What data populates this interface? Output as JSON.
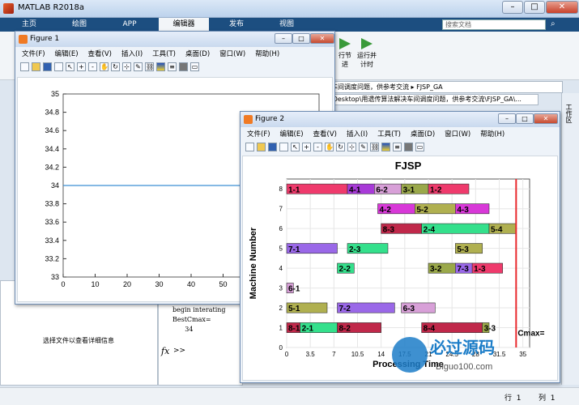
{
  "app": {
    "title": "MATLAB R2018a"
  },
  "ribbon_tabs": [
    "主页",
    "绘图",
    "APP",
    "编辑器",
    "发布",
    "视图"
  ],
  "search_placeholder": "搜索文档",
  "ribbon_buttons": [
    {
      "label": "行节\n进"
    },
    {
      "label": "运行并\n计时"
    }
  ],
  "address": {
    "path1": "车间调度问题，供参考交流 ▸ FJSP_GA",
    "path2": "\\Desktop\\用遗传算法解决车间调度问题，供参考交流\\FJSP_GA\\..."
  },
  "left_pane": {
    "message": "选择文件以查看详细信息"
  },
  "command_window": {
    "lines": [
      "begin interating",
      "BestCmax=",
      "      34"
    ],
    "prompt": ">>"
  },
  "side_label": "工作区",
  "status": {
    "row_label": "行",
    "row_value": "1",
    "col_label": "列",
    "col_value": "1"
  },
  "figure1": {
    "title": "Figure 1",
    "menu": [
      "文件(F)",
      "编辑(E)",
      "查看(V)",
      "插入(I)",
      "工具(T)",
      "桌面(D)",
      "窗口(W)",
      "帮助(H)"
    ],
    "yticks": [
      "35",
      "34.8",
      "34.6",
      "34.4",
      "34.2",
      "34",
      "33.8",
      "33.6",
      "33.4",
      "33.2",
      "33"
    ],
    "xticks": [
      "0",
      "10",
      "20",
      "30",
      "40",
      "50",
      "60",
      "70"
    ]
  },
  "figure2": {
    "title": "Figure 2",
    "menu": [
      "文件(F)",
      "编辑(E)",
      "查看(V)",
      "插入(I)",
      "工具(T)",
      "桌面(D)",
      "窗口(W)",
      "帮助(H)"
    ]
  },
  "chart_data": [
    {
      "type": "line",
      "ylim": [
        33,
        35
      ],
      "xlim": [
        0,
        80
      ],
      "x": [
        0,
        100
      ],
      "series": [
        {
          "values": [
            34,
            34
          ]
        }
      ],
      "yticks": [
        35,
        34.8,
        34.6,
        34.4,
        34.2,
        34,
        33.8,
        33.6,
        33.4,
        33.2,
        33
      ],
      "xticks": [
        0,
        10,
        20,
        30,
        40,
        50,
        60,
        70
      ],
      "color": "#3c8fd4"
    },
    {
      "type": "bar",
      "title": "FJSP",
      "xlabel": "Processing Time",
      "ylabel": "Machine Number",
      "xlim": [
        0,
        36
      ],
      "ylim": [
        0,
        8.5
      ],
      "xticks": [
        "0",
        "3.5",
        "7",
        "10.5",
        "14",
        "17.5",
        "21",
        "24.5",
        "28",
        "31.5",
        "35"
      ],
      "yticks": [
        "0",
        "1",
        "2",
        "3",
        "4",
        "5",
        "6",
        "7",
        "8"
      ],
      "cmax_label": "Cmax=",
      "cmax": 34,
      "cmax_color": "#e8282c",
      "tasks": [
        {
          "m": 8,
          "s": 0,
          "e": 9,
          "label": "1-1",
          "color": "#ef3a6c"
        },
        {
          "m": 8,
          "s": 9,
          "e": 13,
          "label": "4-1",
          "color": "#a83ad8"
        },
        {
          "m": 8,
          "s": 13,
          "e": 17,
          "label": "6-2",
          "color": "#d8a0d8"
        },
        {
          "m": 8,
          "s": 17,
          "e": 21,
          "label": "3-1",
          "color": "#9aa84a"
        },
        {
          "m": 8,
          "s": 21,
          "e": 27,
          "label": "1-2",
          "color": "#ef3a6c"
        },
        {
          "m": 7,
          "s": 13.5,
          "e": 19,
          "label": "4-2",
          "color": "#d838d8"
        },
        {
          "m": 7,
          "s": 19,
          "e": 25,
          "label": "5-2",
          "color": "#b0b050"
        },
        {
          "m": 7,
          "s": 25,
          "e": 30,
          "label": "4-3",
          "color": "#d838d8"
        },
        {
          "m": 6,
          "s": 14,
          "e": 20,
          "label": "8-3",
          "color": "#c0284a"
        },
        {
          "m": 6,
          "s": 20,
          "e": 30,
          "label": "2-4",
          "color": "#34e08c"
        },
        {
          "m": 6,
          "s": 30,
          "e": 34,
          "label": "5-4",
          "color": "#b0b050"
        },
        {
          "m": 5,
          "s": 0,
          "e": 7.5,
          "label": "7-1",
          "color": "#9a68e8"
        },
        {
          "m": 5,
          "s": 9,
          "e": 15,
          "label": "2-3",
          "color": "#34e08c"
        },
        {
          "m": 5,
          "s": 25,
          "e": 29,
          "label": "5-3",
          "color": "#b0b050"
        },
        {
          "m": 4,
          "s": 7.5,
          "e": 10,
          "label": "2-2",
          "color": "#34e08c"
        },
        {
          "m": 4,
          "s": 21,
          "e": 25,
          "label": "3-2",
          "color": "#9aa84a"
        },
        {
          "m": 4,
          "s": 25,
          "e": 27.5,
          "label": "7-3",
          "color": "#9a68e8"
        },
        {
          "m": 4,
          "s": 27.5,
          "e": 32,
          "label": "1-3",
          "color": "#ef3a6c"
        },
        {
          "m": 3,
          "s": 0,
          "e": 1,
          "label": "6-1",
          "color": "#d8a0d8"
        },
        {
          "m": 2,
          "s": 0,
          "e": 6,
          "label": "5-1",
          "color": "#b0b050"
        },
        {
          "m": 2,
          "s": 7.5,
          "e": 16,
          "label": "7-2",
          "color": "#9a68e8"
        },
        {
          "m": 2,
          "s": 17,
          "e": 22,
          "label": "6-3",
          "color": "#d8a0d8"
        },
        {
          "m": 1,
          "s": 0,
          "e": 2,
          "label": "8-1",
          "color": "#c0284a"
        },
        {
          "m": 1,
          "s": 2,
          "e": 7.5,
          "label": "2-1",
          "color": "#34e08c"
        },
        {
          "m": 1,
          "s": 7.5,
          "e": 14,
          "label": "8-2",
          "color": "#c0284a"
        },
        {
          "m": 1,
          "s": 20,
          "e": 29,
          "label": "8-4",
          "color": "#c0284a"
        },
        {
          "m": 1,
          "s": 29,
          "e": 30,
          "label": "3-3",
          "color": "#9aa84a"
        }
      ]
    }
  ],
  "watermark": {
    "text1": "必过源码",
    "text2": "Biguo100.com"
  }
}
